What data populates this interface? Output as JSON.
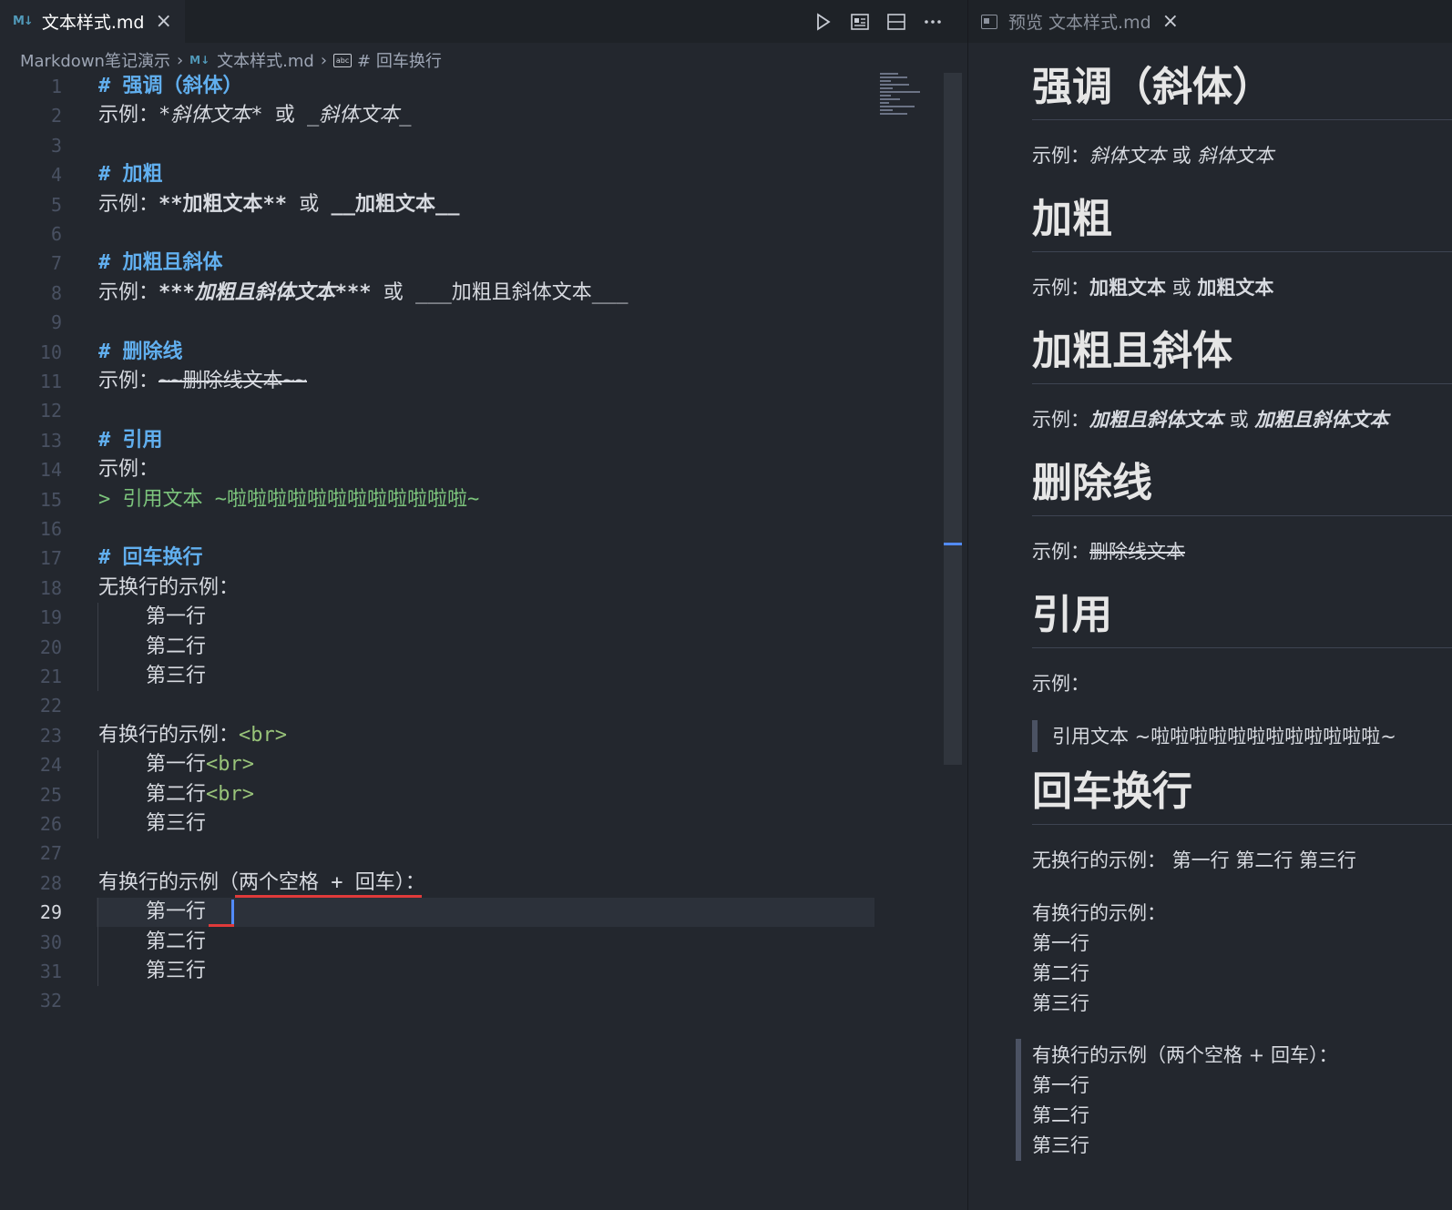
{
  "editor": {
    "tab": {
      "label": "文本样式.md",
      "icon": "M↓"
    },
    "breadcrumb": {
      "folder": "Markdown笔记演示",
      "file": "文本样式.md",
      "symbol": "# 回车换行"
    },
    "lines": [
      {
        "n": "1",
        "parts": [
          {
            "t": "# 强调（斜体）",
            "c": "h"
          }
        ]
      },
      {
        "n": "2",
        "parts": [
          {
            "t": "示例："
          },
          {
            "t": "*斜体文本*",
            "c": "i"
          },
          {
            "t": " 或 "
          },
          {
            "t": "_斜体文本_",
            "c": "i"
          }
        ]
      },
      {
        "n": "3",
        "parts": []
      },
      {
        "n": "4",
        "parts": [
          {
            "t": "# 加粗",
            "c": "h"
          }
        ]
      },
      {
        "n": "5",
        "parts": [
          {
            "t": "示例："
          },
          {
            "t": "**加粗文本**",
            "c": "b"
          },
          {
            "t": " 或 "
          },
          {
            "t": "__加粗文本__",
            "c": "b"
          }
        ]
      },
      {
        "n": "6",
        "parts": []
      },
      {
        "n": "7",
        "parts": [
          {
            "t": "# 加粗且斜体",
            "c": "h"
          }
        ]
      },
      {
        "n": "8",
        "parts": [
          {
            "t": "示例："
          },
          {
            "t": "***加粗且斜体文本***",
            "c": "bi"
          },
          {
            "t": " 或 ___加粗且斜体文本___"
          }
        ]
      },
      {
        "n": "9",
        "parts": []
      },
      {
        "n": "10",
        "parts": [
          {
            "t": "# 删除线",
            "c": "h"
          }
        ]
      },
      {
        "n": "11",
        "parts": [
          {
            "t": "示例："
          },
          {
            "t": "~~删除线文本~~",
            "c": "s"
          }
        ]
      },
      {
        "n": "12",
        "parts": []
      },
      {
        "n": "13",
        "parts": [
          {
            "t": "# 引用",
            "c": "h"
          }
        ]
      },
      {
        "n": "14",
        "parts": [
          {
            "t": "示例："
          }
        ]
      },
      {
        "n": "15",
        "parts": [
          {
            "t": "> 引用文本 ~啦啦啦啦啦啦啦啦啦啦啦啦~",
            "c": "q"
          }
        ]
      },
      {
        "n": "16",
        "parts": []
      },
      {
        "n": "17",
        "parts": [
          {
            "t": "# 回车换行",
            "c": "h"
          }
        ]
      },
      {
        "n": "18",
        "parts": [
          {
            "t": "无换行的示例："
          }
        ]
      },
      {
        "n": "19",
        "indent": true,
        "parts": [
          {
            "t": "第一行"
          }
        ]
      },
      {
        "n": "20",
        "indent": true,
        "parts": [
          {
            "t": "第二行"
          }
        ]
      },
      {
        "n": "21",
        "indent": true,
        "parts": [
          {
            "t": "第三行"
          }
        ]
      },
      {
        "n": "22",
        "parts": []
      },
      {
        "n": "23",
        "parts": [
          {
            "t": "有换行的示例："
          },
          {
            "t": "<br>",
            "c": "tag"
          }
        ]
      },
      {
        "n": "24",
        "indent": true,
        "parts": [
          {
            "t": "第一行"
          },
          {
            "t": "<br>",
            "c": "tag"
          }
        ]
      },
      {
        "n": "25",
        "indent": true,
        "parts": [
          {
            "t": "第二行"
          },
          {
            "t": "<br>",
            "c": "tag"
          }
        ]
      },
      {
        "n": "26",
        "indent": true,
        "parts": [
          {
            "t": "第三行"
          }
        ]
      },
      {
        "n": "27",
        "parts": []
      },
      {
        "n": "28",
        "parts": [
          {
            "t": "有换行的示例（两个空格 + 回车）："
          }
        ]
      },
      {
        "n": "29",
        "indent": true,
        "active": true,
        "parts": [
          {
            "t": "第一行  "
          }
        ]
      },
      {
        "n": "30",
        "indent": true,
        "parts": [
          {
            "t": "第二行"
          }
        ]
      },
      {
        "n": "31",
        "indent": true,
        "parts": [
          {
            "t": "第三行"
          }
        ]
      },
      {
        "n": "32",
        "parts": []
      }
    ]
  },
  "preview": {
    "tab": {
      "label": "预览 文本样式.md"
    },
    "blocks": [
      {
        "type": "h1",
        "text": "强调（斜体）"
      },
      {
        "type": "p",
        "parts": [
          {
            "t": "示例："
          },
          {
            "t": "斜体文本",
            "c": "em"
          },
          {
            "t": " 或 "
          },
          {
            "t": "斜体文本",
            "c": "em"
          }
        ]
      },
      {
        "type": "h1",
        "text": "加粗"
      },
      {
        "type": "p",
        "parts": [
          {
            "t": "示例："
          },
          {
            "t": "加粗文本",
            "c": "strong"
          },
          {
            "t": " 或 "
          },
          {
            "t": "加粗文本",
            "c": "strong"
          }
        ]
      },
      {
        "type": "h1",
        "text": "加粗且斜体"
      },
      {
        "type": "p",
        "parts": [
          {
            "t": "示例："
          },
          {
            "t": "加粗且斜体文本",
            "c": "strong em"
          },
          {
            "t": " 或 "
          },
          {
            "t": "加粗且斜体文本",
            "c": "strong em"
          }
        ]
      },
      {
        "type": "h1",
        "text": "删除线"
      },
      {
        "type": "p",
        "parts": [
          {
            "t": "示例："
          },
          {
            "t": "删除线文本",
            "c": "del"
          }
        ]
      },
      {
        "type": "h1",
        "text": "引用"
      },
      {
        "type": "p",
        "parts": [
          {
            "t": "示例："
          }
        ]
      },
      {
        "type": "quote",
        "lines": [
          "引用文本 ~啦啦啦啦啦啦啦啦啦啦啦啦~"
        ]
      },
      {
        "type": "h1",
        "text": "回车换行"
      },
      {
        "type": "p",
        "parts": [
          {
            "t": "无换行的示例： 第一行 第二行 第三行"
          }
        ]
      },
      {
        "type": "lines",
        "lines": [
          "有换行的示例：",
          "第一行",
          "第二行",
          "第三行"
        ]
      },
      {
        "type": "quote",
        "lines": [
          "有换行的示例（两个空格 + 回车）：",
          "第一行",
          "第二行",
          "第三行"
        ]
      }
    ]
  }
}
